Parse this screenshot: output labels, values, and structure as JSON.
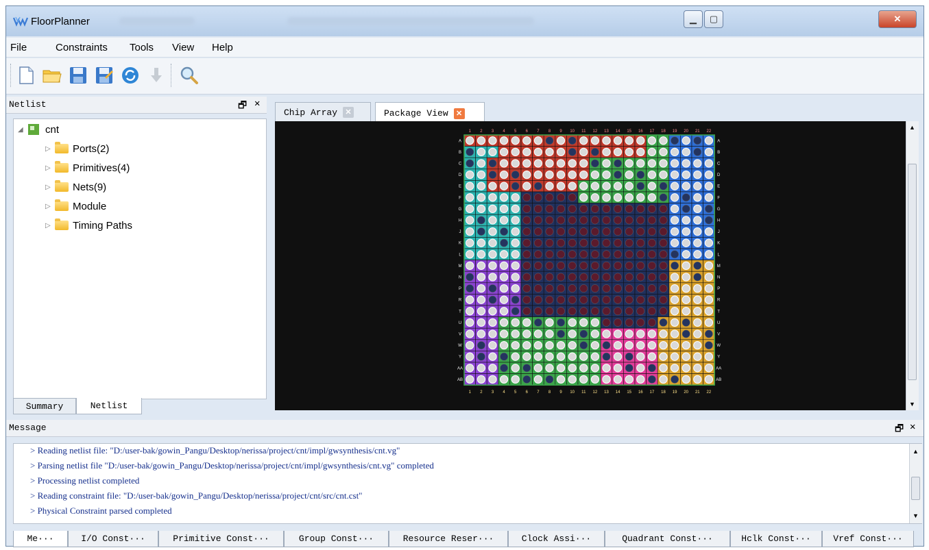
{
  "window": {
    "title": "FloorPlanner"
  },
  "menu": {
    "file": "File",
    "constraints": "Constraints",
    "tools": "Tools",
    "view": "View",
    "help": "Help"
  },
  "toolbar": {
    "icons": [
      "new-file-icon",
      "open-folder-icon",
      "save-icon",
      "save-as-icon",
      "refresh-icon",
      "download-icon",
      "search-icon"
    ]
  },
  "netlist_panel": {
    "title": "Netlist",
    "root": "cnt",
    "items": [
      {
        "label": "Ports(2)"
      },
      {
        "label": "Primitives(4)"
      },
      {
        "label": "Nets(9)"
      },
      {
        "label": "Module"
      },
      {
        "label": "Timing Paths"
      }
    ],
    "tabs": [
      "Summary",
      "Netlist"
    ],
    "active_tab": "Netlist"
  },
  "doc_tabs": {
    "chip_array": "Chip Array",
    "package_view": "Package View",
    "active": "Package View"
  },
  "package": {
    "columns": [
      "1",
      "2",
      "3",
      "4",
      "5",
      "6",
      "7",
      "8",
      "9",
      "10",
      "11",
      "12",
      "13",
      "14",
      "15",
      "16",
      "17",
      "18",
      "19",
      "20",
      "21",
      "22"
    ],
    "rows": [
      "A",
      "B",
      "C",
      "D",
      "E",
      "F",
      "G",
      "H",
      "J",
      "K",
      "L",
      "M",
      "N",
      "P",
      "R",
      "T",
      "U",
      "V",
      "W",
      "Y",
      "AA",
      "AB"
    ],
    "colors": {
      "red": "#c0392b",
      "green": "#3aa44a",
      "blue": "#2e6fd8",
      "cyan": "#2bb3b0",
      "navy": "#20305e",
      "purple": "#8a43d1",
      "pink": "#e33d9a",
      "orange": "#d9a12b",
      "darkred": "#6e1f2a"
    }
  },
  "message_panel": {
    "title": "Message",
    "lines": [
      "> Reading netlist file: \"D:/user-bak/gowin_Pangu/Desktop/nerissa/project/cnt/impl/gwsynthesis/cnt.vg\"",
      "> Parsing netlist file \"D:/user-bak/gowin_Pangu/Desktop/nerissa/project/cnt/impl/gwsynthesis/cnt.vg\" completed",
      "> Processing netlist completed",
      "> Reading constraint file: \"D:/user-bak/gowin_Pangu/Desktop/nerissa/project/cnt/src/cnt.cst\"",
      "> Physical Constraint parsed completed"
    ]
  },
  "bottom_tabs": [
    "Me···",
    "I/O Const···",
    "Primitive Const···",
    "Group Const···",
    "Resource Reser···",
    "Clock Assi···",
    "Quadrant Const···",
    "Hclk Const···",
    "Vref Const···"
  ]
}
